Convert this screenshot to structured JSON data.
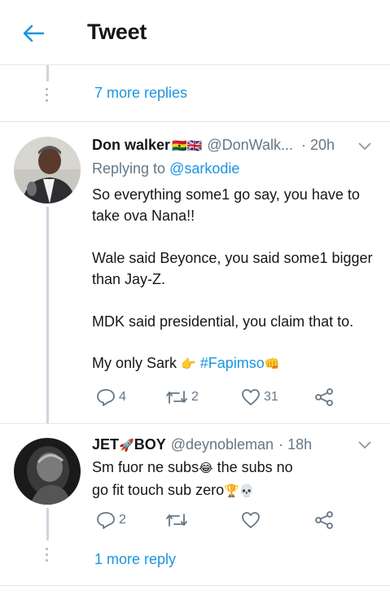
{
  "header": {
    "title": "Tweet"
  },
  "thread": {
    "more_replies_top": "7 more replies",
    "more_replies_bottom": "1 more reply"
  },
  "tweets": [
    {
      "name": "Don walker",
      "name_emoji": "🇬🇭🇬🇧",
      "handle": "@DonWalk...",
      "time": "· 20h",
      "replying_prefix": "Replying to",
      "replying_handle": "@sarkodie",
      "lines": [
        "So everything some1 go say, you have to take ova Nana!!",
        "Wale said Beyonce, you said some1 bigger than Jay-Z.",
        "MDK said presidential, you claim that to."
      ],
      "last_line_text": "My only Sark",
      "last_line_emoji1": "👉",
      "hashtag": "#Fapimso",
      "last_line_emoji2": "👊",
      "replies": "4",
      "retweets": "2",
      "likes": "31"
    },
    {
      "name_part1": "JET",
      "name_emoji": "🚀",
      "name_part2": "BOY",
      "handle": "@deynobleman",
      "time": "· 18h",
      "text_part1": "Sm fuor ne subs",
      "emoji1": "😂",
      "text_part2": " the subs no go fit touch sub zero",
      "emoji2": "🏆💀",
      "replies": "2",
      "retweets": "",
      "likes": ""
    }
  ],
  "colors": {
    "accent": "#1b95e0",
    "secondary": "#657786",
    "border": "#e1e8ed"
  }
}
